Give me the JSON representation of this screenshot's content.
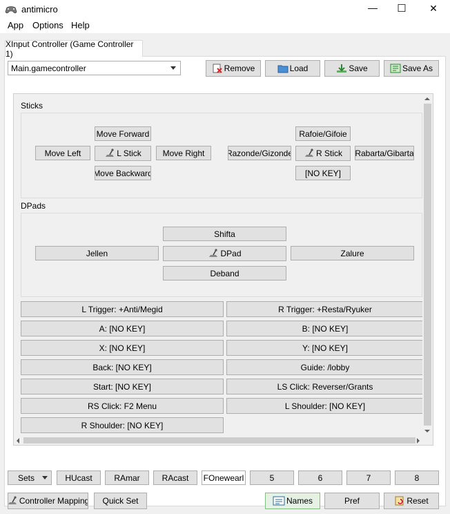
{
  "window": {
    "title": "antimicro",
    "minimize": "—",
    "maximize": "☐",
    "close": "✕"
  },
  "menu": {
    "app": "App",
    "options": "Options",
    "help": "Help"
  },
  "tab": {
    "label": "XInput Controller (Game Controller 1)"
  },
  "profile": {
    "selected": "Main.gamecontroller"
  },
  "toolbar": {
    "remove": "Remove",
    "load": "Load",
    "save": "Save",
    "save_as": "Save As"
  },
  "sticks": {
    "title": "Sticks",
    "left": {
      "up": "Move Forward",
      "left": "Move Left",
      "center": "L Stick",
      "right": "Move Right",
      "down": "Move Backward"
    },
    "right": {
      "up": "Rafoie/Gifoie",
      "left": "Razonde/Gizonde",
      "center": "R Stick",
      "right": "Rabarta/Gibarta",
      "down": "[NO KEY]"
    }
  },
  "dpads": {
    "title": "DPads",
    "up": "Shifta",
    "left": "Jellen",
    "center": "DPad",
    "right": "Zalure",
    "down": "Deband"
  },
  "buttons": {
    "l_trigger": "L Trigger: +Anti/Megid",
    "r_trigger": "R Trigger: +Resta/Ryuker",
    "a": "A: [NO KEY]",
    "b": "B: [NO KEY]",
    "x": "X: [NO KEY]",
    "y": "Y: [NO KEY]",
    "back": "Back: [NO KEY]",
    "guide": "Guide: /lobby",
    "start": "Start: [NO KEY]",
    "ls_click": "LS Click: Reverser/Grants",
    "rs_click": "RS Click: F2 Menu",
    "l_shoulder": "L Shoulder: [NO KEY]",
    "r_shoulder": "R Shoulder: [NO KEY]"
  },
  "sets": {
    "label": "Sets",
    "set1": "HUcast",
    "set2": "RAmar",
    "set3": "RAcast",
    "set4": "FOnewearl",
    "set5": "5",
    "set6": "6",
    "set7": "7",
    "set8": "8"
  },
  "bottom": {
    "controller_mapping": "Controller Mapping",
    "quick_set": "Quick Set",
    "names": "Names",
    "pref": "Pref",
    "reset": "Reset"
  },
  "colors": {
    "window_bg": "#f0f0f0",
    "button_bg": "#e1e1e1",
    "button_border": "#adadad",
    "names_active": "#e5f1e5"
  }
}
